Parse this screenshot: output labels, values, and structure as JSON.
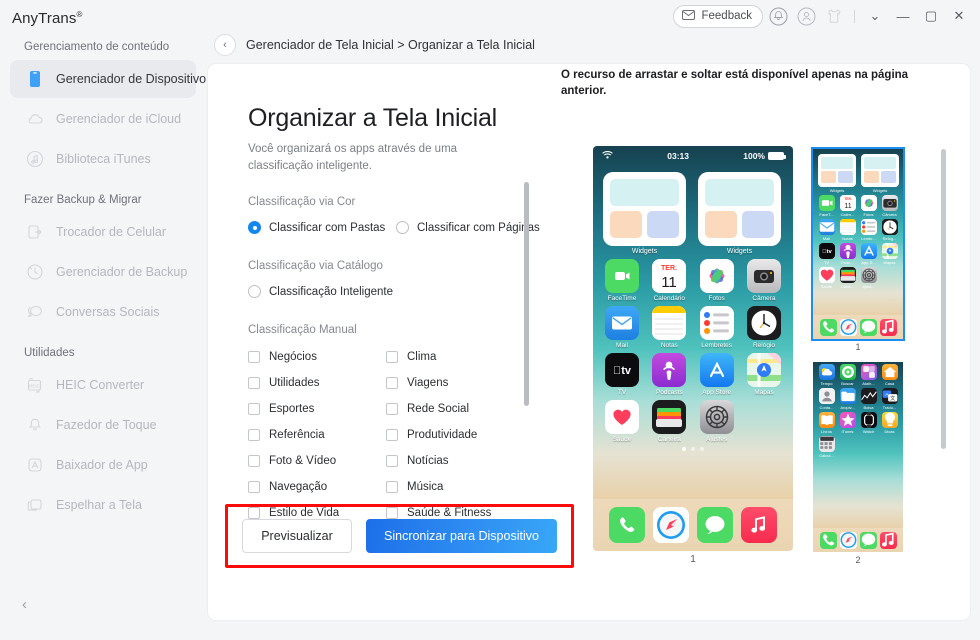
{
  "brand": {
    "name": "AnyTrans",
    "mark": "®"
  },
  "sidebar": {
    "groups": [
      {
        "title": "Gerenciamento de conteúdo",
        "items": [
          {
            "label": "Gerenciador de Dispositivo",
            "icon": "device-icon",
            "active": true
          },
          {
            "label": "Gerenciador de iCloud",
            "icon": "cloud-icon",
            "active": false
          },
          {
            "label": "Biblioteca iTunes",
            "icon": "music-note-icon",
            "active": false
          }
        ]
      },
      {
        "title": "Fazer Backup & Migrar",
        "items": [
          {
            "label": "Trocador de Celular",
            "icon": "phone-switch-icon",
            "active": false
          },
          {
            "label": "Gerenciador de Backup",
            "icon": "clock-history-icon",
            "active": false
          },
          {
            "label": "Conversas Sociais",
            "icon": "chat-bubbles-icon",
            "active": false
          }
        ]
      },
      {
        "title": "Utilidades",
        "items": [
          {
            "label": "HEIC Converter",
            "icon": "heic-icon",
            "active": false
          },
          {
            "label": "Fazedor de Toque",
            "icon": "bell-icon",
            "active": false
          },
          {
            "label": "Baixador de App",
            "icon": "appstore-icon",
            "active": false
          },
          {
            "label": "Espelhar a Tela",
            "icon": "screen-mirror-icon",
            "active": false
          }
        ]
      }
    ],
    "collapse_label": "‹"
  },
  "topbar": {
    "feedback_label": "Feedback",
    "icons": [
      {
        "name": "envelope-icon"
      },
      {
        "name": "bell-icon"
      },
      {
        "name": "account-icon"
      },
      {
        "name": "theme-shirt-icon"
      }
    ],
    "window": {
      "menu": "⌄",
      "minimize": "—",
      "maximize": "▢",
      "close": "✕"
    }
  },
  "breadcrumb": {
    "back": "‹",
    "text": "Gerenciador de Tela Inicial > Organizar a Tela Inicial"
  },
  "main": {
    "title": "Organizar a Tela Inicial",
    "subtitle": "Você organizará os apps através de uma classificação inteligente.",
    "color_section": {
      "label": "Classificação via Cor",
      "options": [
        {
          "label": "Classificar com Pastas",
          "selected": true
        },
        {
          "label": "Classificar com Páginas",
          "selected": false
        }
      ]
    },
    "catalog_section": {
      "label": "Classificação via Catálogo",
      "options": [
        {
          "label": "Classificação Inteligente",
          "selected": false
        }
      ]
    },
    "manual_section": {
      "label": "Classificação Manual",
      "checkboxes": [
        {
          "label": "Negócios",
          "checked": false
        },
        {
          "label": "Clima",
          "checked": false
        },
        {
          "label": "Utilidades",
          "checked": false
        },
        {
          "label": "Viagens",
          "checked": false
        },
        {
          "label": "Esportes",
          "checked": false
        },
        {
          "label": "Rede Social",
          "checked": false
        },
        {
          "label": "Referência",
          "checked": false
        },
        {
          "label": "Produtividade",
          "checked": false
        },
        {
          "label": "Foto & Vídeo",
          "checked": false
        },
        {
          "label": "Notícias",
          "checked": false
        },
        {
          "label": "Navegação",
          "checked": false
        },
        {
          "label": "Música",
          "checked": false
        },
        {
          "label": "Estilo de Vida",
          "checked": false
        },
        {
          "label": "Saúde & Fitness",
          "checked": false
        }
      ]
    },
    "actions": {
      "preview_label": "Previsualizar",
      "sync_label": "Sincronizar para Dispositivo",
      "highlight_color": "#fd0b0b",
      "primary_color": "#2f8ef2"
    }
  },
  "preview": {
    "notice": "O recurso de arrastar e soltar está disponível apenas na página anterior.",
    "phone": {
      "status": {
        "wifi": "wifi-icon",
        "time": "03:13",
        "battery_pct": "100%"
      },
      "widgets": [
        {
          "label": "Widgets"
        },
        {
          "label": "Widgets"
        }
      ],
      "rows": [
        [
          {
            "name": "FaceTime",
            "icon": "facetime-icon"
          },
          {
            "name": "Calendário",
            "icon": "calendar-icon"
          },
          {
            "name": "Fotos",
            "icon": "photos-icon"
          },
          {
            "name": "Câmera",
            "icon": "camera-icon"
          }
        ],
        [
          {
            "name": "Mail",
            "icon": "mail-icon"
          },
          {
            "name": "Notas",
            "icon": "notes-icon"
          },
          {
            "name": "Lembretes",
            "icon": "reminders-icon"
          },
          {
            "name": "Relógio",
            "icon": "clock-icon"
          }
        ],
        [
          {
            "name": "TV",
            "icon": "appletv-icon"
          },
          {
            "name": "Podcasts",
            "icon": "podcasts-icon"
          },
          {
            "name": "App Store",
            "icon": "appstore-icon"
          },
          {
            "name": "Mapas",
            "icon": "maps-icon"
          }
        ],
        [
          {
            "name": "Saúde",
            "icon": "health-icon"
          },
          {
            "name": "Carteira",
            "icon": "wallet-icon"
          },
          {
            "name": "Ajustes",
            "icon": "settings-icon"
          }
        ]
      ],
      "dots": {
        "count": 3,
        "active_index": 0
      },
      "dock": [
        {
          "name": "Telefone",
          "icon": "phone-icon"
        },
        {
          "name": "Safari",
          "icon": "safari-icon"
        },
        {
          "name": "Mensagens",
          "icon": "messages-icon"
        },
        {
          "name": "Música",
          "icon": "music-icon"
        }
      ],
      "page_label": "1"
    },
    "thumbnails": [
      {
        "page_label": "1",
        "selected": true,
        "widgets": [
          {
            "label": "Widgets"
          },
          {
            "label": "Widgets"
          }
        ],
        "rows": [
          [
            {
              "name": "FaceT...",
              "icon": "facetime-icon"
            },
            {
              "name": "Calen...",
              "icon": "calendar-icon"
            },
            {
              "name": "Fotos",
              "icon": "photos-icon"
            },
            {
              "name": "Câmera",
              "icon": "camera-icon"
            }
          ],
          [
            {
              "name": "Mail",
              "icon": "mail-icon"
            },
            {
              "name": "Notas",
              "icon": "notes-icon"
            },
            {
              "name": "Lembr...",
              "icon": "reminders-icon"
            },
            {
              "name": "Relóg...",
              "icon": "clock-icon"
            }
          ],
          [
            {
              "name": "TV",
              "icon": "appletv-icon"
            },
            {
              "name": "Podc...",
              "icon": "podcasts-icon"
            },
            {
              "name": "App S...",
              "icon": "appstore-icon"
            },
            {
              "name": "Mapas",
              "icon": "maps-icon"
            }
          ],
          [
            {
              "name": "Saúde",
              "icon": "health-icon"
            },
            {
              "name": "Carte...",
              "icon": "wallet-icon"
            },
            {
              "name": "Ajust...",
              "icon": "settings-icon"
            }
          ]
        ],
        "dock": [
          {
            "name": "Telefone",
            "icon": "phone-icon"
          },
          {
            "name": "Safari",
            "icon": "safari-icon"
          },
          {
            "name": "Mensagens",
            "icon": "messages-icon"
          },
          {
            "name": "Música",
            "icon": "music-icon"
          }
        ]
      },
      {
        "page_label": "2",
        "selected": false,
        "widgets": [],
        "rows": [
          [
            {
              "name": "Tempo",
              "icon": "weather-icon"
            },
            {
              "name": "Buscar",
              "icon": "findmy-icon"
            },
            {
              "name": "Atalh...",
              "icon": "shortcuts-icon"
            },
            {
              "name": "Casa",
              "icon": "home-icon"
            }
          ],
          [
            {
              "name": "Conta...",
              "icon": "contacts-icon"
            },
            {
              "name": "Arquiv...",
              "icon": "files-icon"
            },
            {
              "name": "Bolsa",
              "icon": "stocks-icon"
            },
            {
              "name": "Tradu...",
              "icon": "translate-icon"
            }
          ],
          [
            {
              "name": "Livros",
              "icon": "books-icon"
            },
            {
              "name": "iTunes",
              "icon": "itunes-icon"
            },
            {
              "name": "Watch",
              "icon": "watch-icon"
            },
            {
              "name": "Dicas",
              "icon": "tips-icon"
            }
          ],
          [
            {
              "name": "Calcul...",
              "icon": "calculator-icon"
            }
          ]
        ],
        "dock": [
          {
            "name": "Telefone",
            "icon": "phone-icon"
          },
          {
            "name": "Safari",
            "icon": "safari-icon"
          },
          {
            "name": "Mensagens",
            "icon": "messages-icon"
          },
          {
            "name": "Música",
            "icon": "music-icon"
          }
        ]
      }
    ]
  }
}
